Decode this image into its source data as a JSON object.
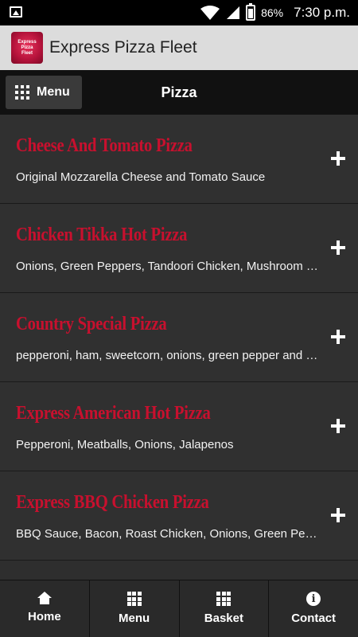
{
  "status_bar": {
    "battery_percent": "86%",
    "time": "7:30 p.m.",
    "icons": [
      "gallery-icon",
      "wifi-icon",
      "signal-icon",
      "battery-icon"
    ]
  },
  "app_bar": {
    "title": "Express Pizza Fleet",
    "logo_text": [
      "Express",
      "Pizza",
      "Fleet"
    ]
  },
  "top_nav": {
    "menu_label": "Menu",
    "page_title": "Pizza"
  },
  "products": [
    {
      "name": "Cheese And Tomato Pizza",
      "description": "Original Mozzarella Cheese and Tomato Sauce"
    },
    {
      "name": "Chicken Tikka Hot Pizza",
      "description": "Onions, Green Peppers, Tandoori Chicken, Mushroom a..."
    },
    {
      "name": "Country Special Pizza",
      "description": "pepperoni, ham, sweetcorn, onions, green pepper and pi..."
    },
    {
      "name": "Express American Hot Pizza",
      "description": "Pepperoni, Meatballs, Onions, Jalapenos"
    },
    {
      "name": "Express BBQ Chicken Pizza",
      "description": "BBQ Sauce, Bacon, Roast Chicken, Onions, Green Pepper"
    }
  ],
  "bottom_nav": {
    "tabs": [
      {
        "label": "Home",
        "icon": "home-icon"
      },
      {
        "label": "Menu",
        "icon": "grid-icon"
      },
      {
        "label": "Basket",
        "icon": "grid-icon"
      },
      {
        "label": "Contact",
        "icon": "info-icon"
      }
    ]
  },
  "colors": {
    "accent_red": "#c8102e",
    "list_background": "#303030",
    "app_bar": "#dcdcdc"
  }
}
